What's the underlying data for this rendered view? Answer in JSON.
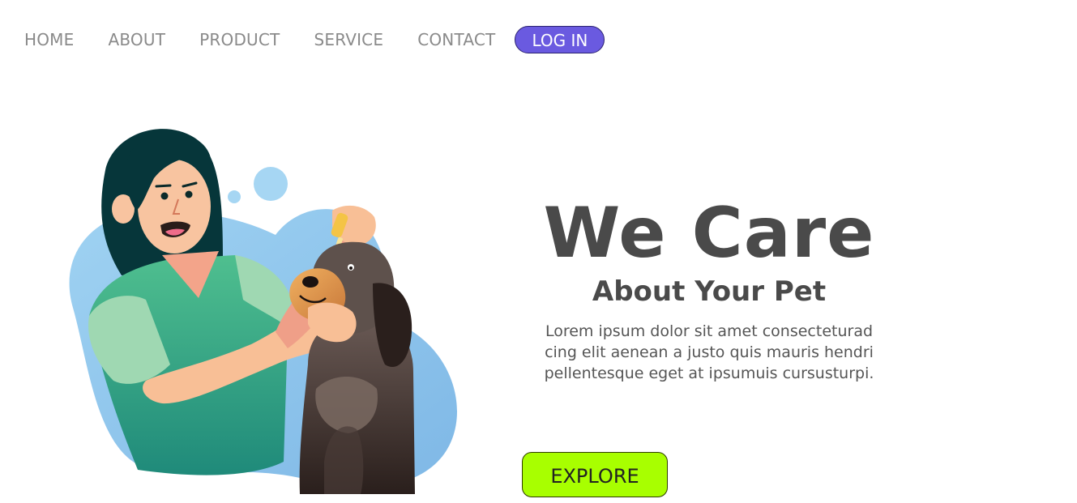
{
  "nav": {
    "items": [
      {
        "label": "HOME"
      },
      {
        "label": "ABOUT"
      },
      {
        "label": "PRODUCT"
      },
      {
        "label": "SERVICE"
      },
      {
        "label": "CONTACT"
      }
    ],
    "login_label": "LOG IN"
  },
  "hero": {
    "title": "We Care",
    "subtitle": "About Your Pet",
    "body_lines": [
      "Lorem ipsum dolor sit amet consecteturad",
      "cing elit aenean a justo quis mauris hendri",
      "pellentesque eget at ipsumuis cursusturpi."
    ],
    "cta_label": "EXPLORE"
  },
  "illustration": {
    "subject": "woman giving eye drops to dog",
    "icon": "vet-illustration"
  },
  "colors": {
    "accent_purple": "#6a5ae0",
    "accent_lime": "#a8ff00",
    "heading_gray": "#4a4a4a",
    "nav_gray": "#8a8a8a",
    "blob_blue": "#8ec6ea",
    "shirt_green": "#2f9c7c"
  }
}
